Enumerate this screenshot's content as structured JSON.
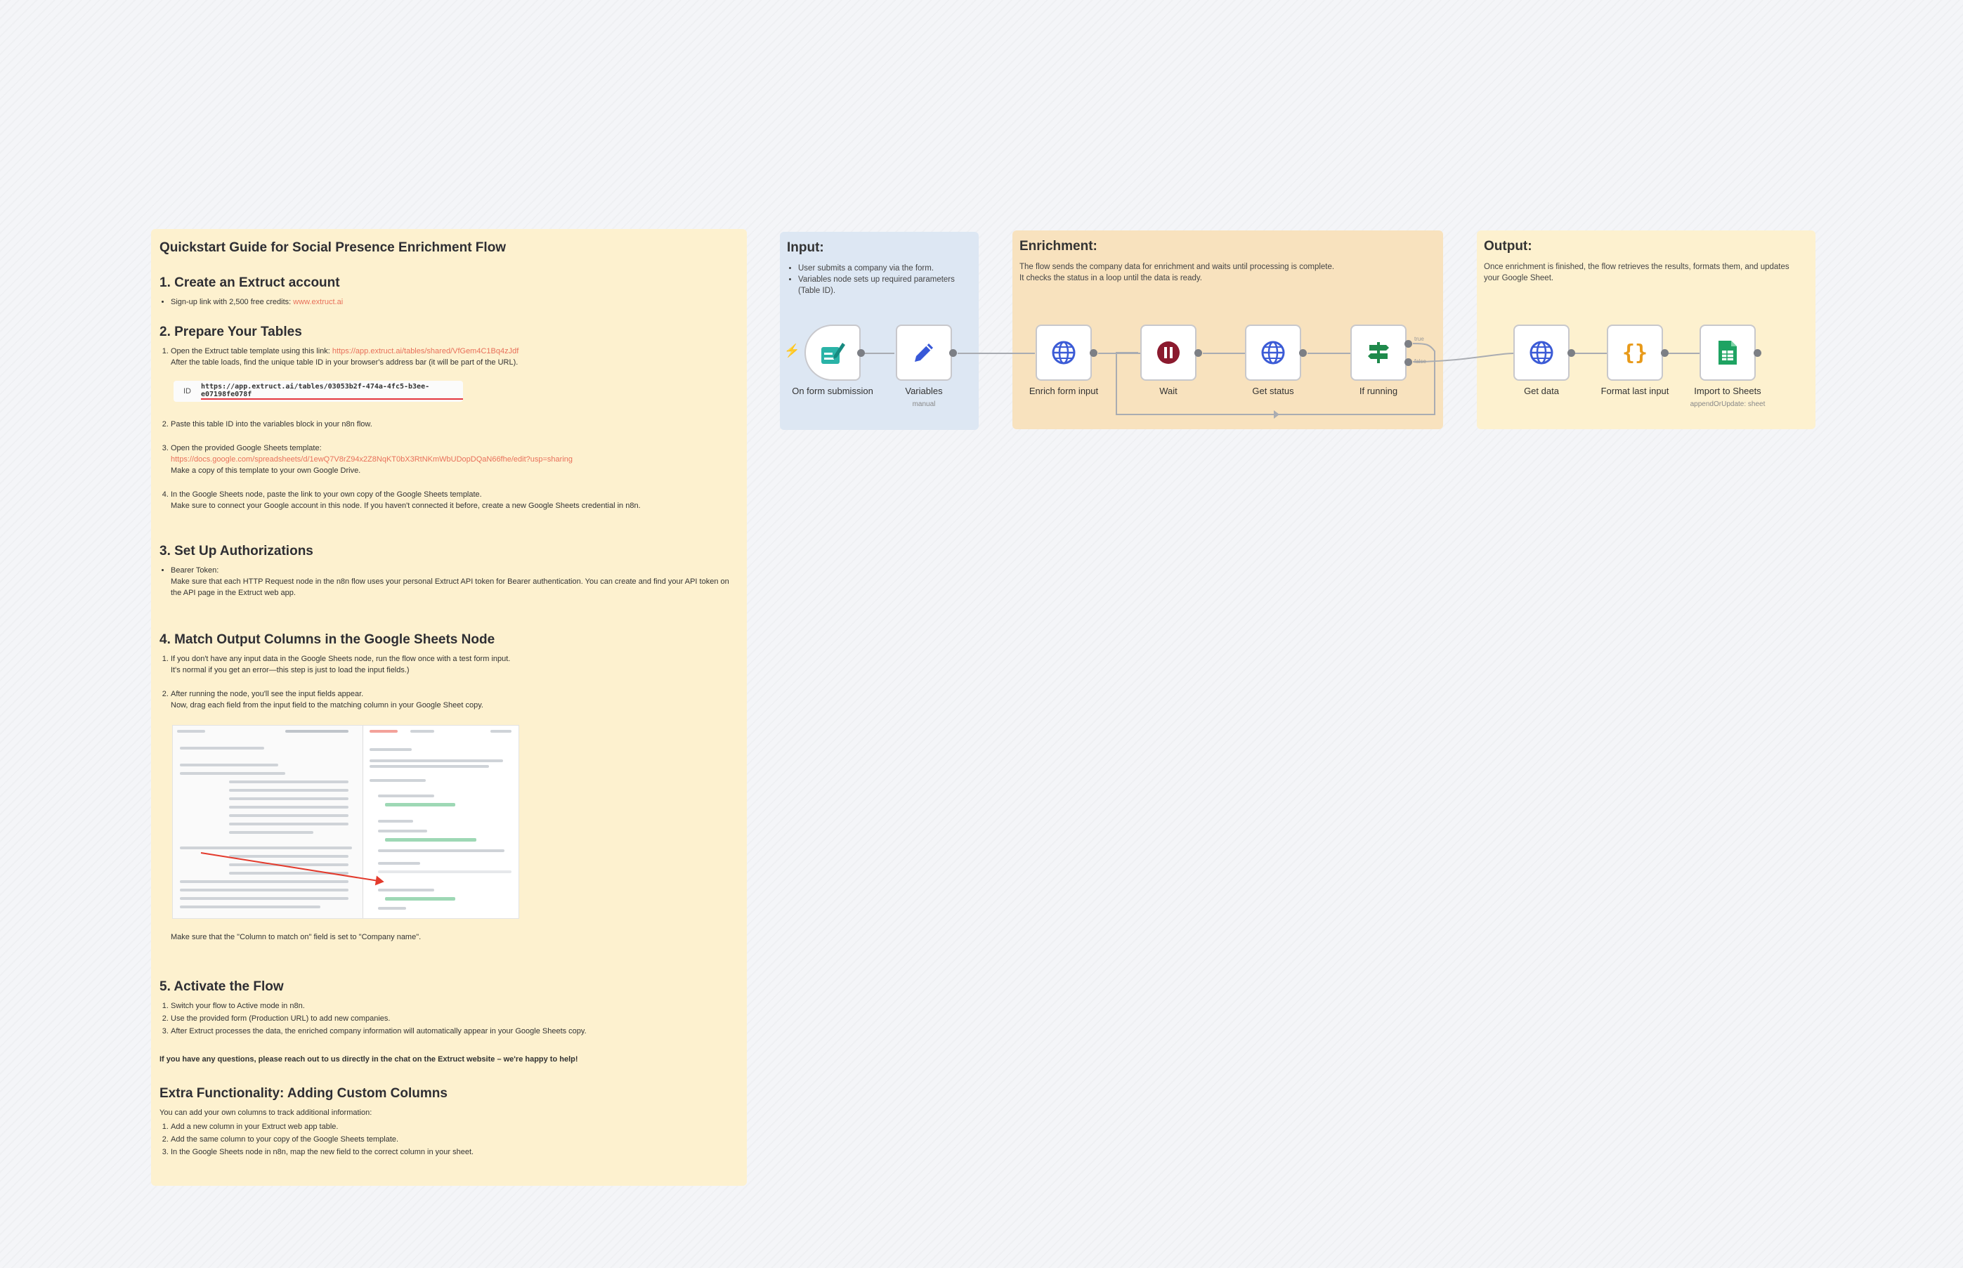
{
  "guide": {
    "title": "Quickstart Guide for Social Presence Enrichment Flow",
    "s1": {
      "heading": "1. Create an Extruct account",
      "signup_text": "Sign-up link with 2,500 free credits: ",
      "signup_link": "www.extruct.ai"
    },
    "s2": {
      "heading": "2. Prepare Your Tables",
      "step1_text": "Open the Extruct table template using this link: ",
      "step1_link": "https://app.extruct.ai/tables/shared/VfGem4C1Bq4zJdf",
      "step1_line2": "After the table loads, find the unique table ID in your browser's address bar (it will be part of the URL).",
      "id_label": "ID",
      "id_url": "https://app.extruct.ai/tables/03053b2f-474a-4fc5-b3ee-e07198fe078f",
      "step2": "Paste this table ID into the variables block in your n8n flow.",
      "step3_text": "Open the provided Google Sheets template:",
      "step3_link": "https://docs.google.com/spreadsheets/d/1ewQ7V8rZ94x2Z8NqKT0bX3RtNKmWbUDopDQaN66fhe/edit?usp=sharing",
      "step3_line2": "Make a copy of this template to your own Google Drive.",
      "step4_text": "In the Google Sheets node, paste the link to your own copy of the Google Sheets template.",
      "step4_line2": "Make sure to connect your Google account in this node. If you haven't connected it before, create a new Google Sheets credential in n8n."
    },
    "s3": {
      "heading": "3. Set Up Authorizations",
      "bearer_label": "Bearer Token:",
      "bearer_text": "Make sure that each HTTP Request node in the n8n flow uses your personal Extruct API token for Bearer authentication. You can create and find your API token on the API page in the Extruct web app."
    },
    "s4": {
      "heading": "4. Match Output Columns in the Google Sheets Node",
      "step1": "If you don't have any input data in the Google Sheets node, run the flow once with a test form input.",
      "step1_line2": "It's normal if you get an error—this step is just to load the input fields.)",
      "step2": "After running the node, you'll see the input fields appear.",
      "step2_line2": "Now, drag each field from the input field to the matching column in your Google Sheet copy.",
      "note": "Make sure that the \"Column to match on\" field is set to \"Company name\"."
    },
    "s5": {
      "heading": "5. Activate the Flow",
      "step1": "Switch your flow to Active mode in n8n.",
      "step2": "Use the provided form (Production URL) to add new companies.",
      "step3": "After Extruct processes the data, the enriched company information will automatically appear in your Google Sheets copy."
    },
    "questions": "If you have any questions, please reach out to us directly in the chat on the Extruct website – we're happy to help!",
    "extra": {
      "heading": "Extra Functionality: Adding Custom Columns",
      "intro": "You can add your own columns to track additional information:",
      "step1": "Add a new column in your Extruct web app table.",
      "step2": "Add the same column to your copy of the Google Sheets template.",
      "step3": "In the Google Sheets node in n8n, map the new field to the correct column in your sheet."
    }
  },
  "notes": {
    "input": {
      "title": "Input:",
      "b1": "User submits a company via the form.",
      "b2": "Variables node sets up required parameters (Table ID)."
    },
    "enrichment": {
      "title": "Enrichment:",
      "line1": "The flow sends the company data for enrichment and waits until processing is complete.",
      "line2": "It checks the status in a loop until the data is ready."
    },
    "output": {
      "title": "Output:",
      "line1": "Once enrichment is finished, the flow retrieves the results, formats them, and updates your Google Sheet."
    }
  },
  "nodes": {
    "form": {
      "label": "On form submission",
      "icon": "form-icon"
    },
    "variables": {
      "label": "Variables",
      "sub": "manual",
      "icon": "pencil-icon"
    },
    "enrich": {
      "label": "Enrich form input",
      "icon": "globe-icon"
    },
    "wait": {
      "label": "Wait",
      "icon": "pause-icon"
    },
    "status": {
      "label": "Get status",
      "icon": "globe-icon"
    },
    "ifrunning": {
      "label": "If running",
      "icon": "branch-icon",
      "out_true": "true",
      "out_false": "false"
    },
    "getdata": {
      "label": "Get data",
      "icon": "globe-icon"
    },
    "format": {
      "label": "Format last input",
      "icon": "braces-icon"
    },
    "sheets": {
      "label": "Import to Sheets",
      "sub": "appendOrUpdate: sheet",
      "icon": "sheets-icon"
    }
  },
  "colors": {
    "guide_bg": "#fdf1cf",
    "input_bg": "#dde7f3",
    "enrich_bg": "#f8e2be",
    "link": "#e8705a",
    "globe": "#3b5bd6",
    "wait": "#8b1a2e",
    "branch": "#1f8a4c",
    "braces": "#e89a1a",
    "sheets": "#1ea362"
  }
}
